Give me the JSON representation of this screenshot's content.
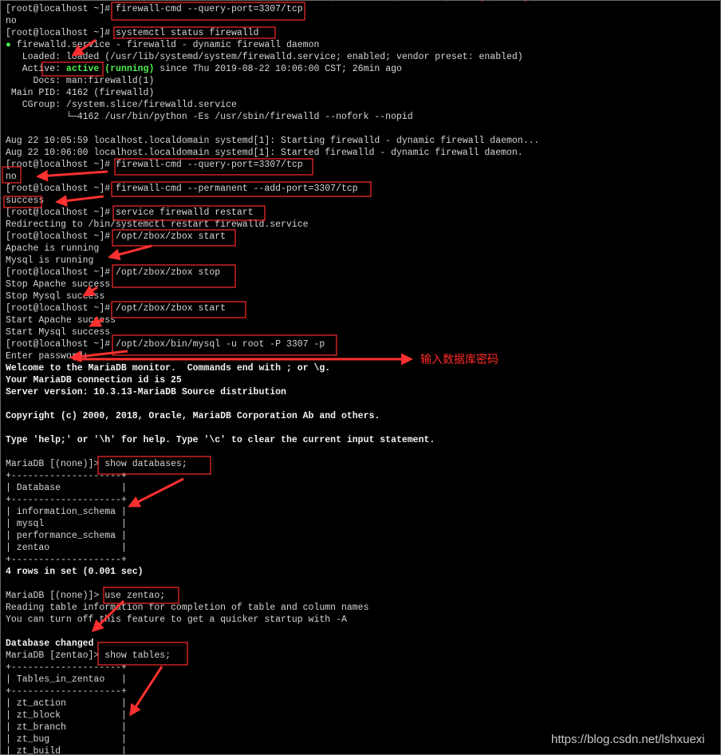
{
  "terminal": {
    "lines": [
      {
        "parts": [
          {
            "t": "Error: INVALID_PORT: bad port (most likely missing protocol), correct syntax is portid[-portid]/protocol",
            "c": "err"
          }
        ]
      },
      {
        "parts": [
          {
            "t": "[root@localhost ~]# firewall-cmd --query-port=3307/tcp"
          }
        ]
      },
      {
        "parts": [
          {
            "t": "no"
          }
        ]
      },
      {
        "parts": [
          {
            "t": "[root@localhost ~]# systemctl status firewalld"
          }
        ]
      },
      {
        "parts": [
          {
            "t": "●",
            "c": "dot"
          },
          {
            "t": " firewalld.service - firewalld - dynamic firewall daemon"
          }
        ]
      },
      {
        "parts": [
          {
            "t": "   Loaded: loaded (/usr/lib/systemd/system/firewalld.service; enabled; vendor preset: enabled)"
          }
        ]
      },
      {
        "parts": [
          {
            "t": "   Active: "
          },
          {
            "t": "active (running)",
            "c": "green"
          },
          {
            "t": " since Thu 2019-08-22 10:06:00 CST; 26min ago"
          }
        ]
      },
      {
        "parts": [
          {
            "t": "     Docs: man:firewalld(1)"
          }
        ]
      },
      {
        "parts": [
          {
            "t": " Main PID: 4162 (firewalld)"
          }
        ]
      },
      {
        "parts": [
          {
            "t": "   CGroup: /system.slice/firewalld.service"
          }
        ]
      },
      {
        "parts": [
          {
            "t": "           └─4162 /usr/bin/python -Es /usr/sbin/firewalld --nofork --nopid"
          }
        ]
      },
      {
        "parts": [
          {
            "t": ""
          }
        ]
      },
      {
        "parts": [
          {
            "t": "Aug 22 10:05:59 localhost.localdomain systemd[1]: Starting firewalld - dynamic firewall daemon..."
          }
        ]
      },
      {
        "parts": [
          {
            "t": "Aug 22 10:06:00 localhost.localdomain systemd[1]: Started firewalld - dynamic firewall daemon."
          }
        ]
      },
      {
        "parts": [
          {
            "t": "[root@localhost ~]# firewall-cmd --query-port=3307/tcp"
          }
        ]
      },
      {
        "parts": [
          {
            "t": "no"
          }
        ]
      },
      {
        "parts": [
          {
            "t": "[root@localhost ~]# firewall-cmd --permanent --add-port=3307/tcp"
          }
        ]
      },
      {
        "parts": [
          {
            "t": "success"
          }
        ]
      },
      {
        "parts": [
          {
            "t": "[root@localhost ~]# service firewalld restart"
          }
        ]
      },
      {
        "parts": [
          {
            "t": "Redirecting to /bin/systemctl restart firewalld.service"
          }
        ]
      },
      {
        "parts": [
          {
            "t": "[root@localhost ~]# /opt/zbox/zbox start"
          }
        ]
      },
      {
        "parts": [
          {
            "t": "Apache is running"
          }
        ]
      },
      {
        "parts": [
          {
            "t": "Mysql is running"
          }
        ]
      },
      {
        "parts": [
          {
            "t": "[root@localhost ~]# /opt/zbox/zbox stop"
          }
        ]
      },
      {
        "parts": [
          {
            "t": "Stop Apache success"
          }
        ]
      },
      {
        "parts": [
          {
            "t": "Stop Mysql success"
          }
        ]
      },
      {
        "parts": [
          {
            "t": "[root@localhost ~]# /opt/zbox/zbox start"
          }
        ]
      },
      {
        "parts": [
          {
            "t": "Start Apache success"
          }
        ]
      },
      {
        "parts": [
          {
            "t": "Start Mysql success"
          }
        ]
      },
      {
        "parts": [
          {
            "t": "[root@localhost ~]# /opt/zbox/bin/mysql -u root -P 3307 -p"
          }
        ]
      },
      {
        "parts": [
          {
            "t": "Enter password: "
          }
        ]
      },
      {
        "parts": [
          {
            "t": "Welcome to the MariaDB monitor.  Commands end with ; or \\g.",
            "c": "b"
          }
        ]
      },
      {
        "parts": [
          {
            "t": "Your MariaDB connection id is 25",
            "c": "b"
          }
        ]
      },
      {
        "parts": [
          {
            "t": "Server version: 10.3.13-MariaDB Source distribution",
            "c": "b"
          }
        ]
      },
      {
        "parts": [
          {
            "t": ""
          }
        ]
      },
      {
        "parts": [
          {
            "t": "Copyright (c) 2000, 2018, Oracle, MariaDB Corporation Ab and others.",
            "c": "b"
          }
        ]
      },
      {
        "parts": [
          {
            "t": ""
          }
        ]
      },
      {
        "parts": [
          {
            "t": "Type 'help;' or '\\h' for help. Type '\\c' to clear the current input statement.",
            "c": "b"
          }
        ]
      },
      {
        "parts": [
          {
            "t": ""
          }
        ]
      },
      {
        "parts": [
          {
            "t": "MariaDB [(none)]> show databases;"
          }
        ]
      },
      {
        "parts": [
          {
            "t": "+--------------------+"
          }
        ]
      },
      {
        "parts": [
          {
            "t": "| Database           |"
          }
        ]
      },
      {
        "parts": [
          {
            "t": "+--------------------+"
          }
        ]
      },
      {
        "parts": [
          {
            "t": "| information_schema |"
          }
        ]
      },
      {
        "parts": [
          {
            "t": "| mysql              |"
          }
        ]
      },
      {
        "parts": [
          {
            "t": "| performance_schema |"
          }
        ]
      },
      {
        "parts": [
          {
            "t": "| zentao             |"
          }
        ]
      },
      {
        "parts": [
          {
            "t": "+--------------------+"
          }
        ]
      },
      {
        "parts": [
          {
            "t": "4 rows in set (0.001 sec)",
            "c": "b"
          }
        ]
      },
      {
        "parts": [
          {
            "t": ""
          }
        ]
      },
      {
        "parts": [
          {
            "t": "MariaDB [(none)]> use zentao;"
          }
        ]
      },
      {
        "parts": [
          {
            "t": "Reading table information for completion of table and column names"
          }
        ]
      },
      {
        "parts": [
          {
            "t": "You can turn off this feature to get a quicker startup with -A"
          }
        ]
      },
      {
        "parts": [
          {
            "t": ""
          }
        ]
      },
      {
        "parts": [
          {
            "t": "Database changed",
            "c": "b"
          }
        ]
      },
      {
        "parts": [
          {
            "t": "MariaDB [zentao]> show tables;"
          }
        ]
      },
      {
        "parts": [
          {
            "t": "+--------------------+"
          }
        ]
      },
      {
        "parts": [
          {
            "t": "| Tables_in_zentao   |"
          }
        ]
      },
      {
        "parts": [
          {
            "t": "+--------------------+"
          }
        ]
      },
      {
        "parts": [
          {
            "t": "| zt_action          |"
          }
        ]
      },
      {
        "parts": [
          {
            "t": "| zt_block           |"
          }
        ]
      },
      {
        "parts": [
          {
            "t": "| zt_branch          |"
          }
        ]
      },
      {
        "parts": [
          {
            "t": "| zt_bug             |"
          }
        ]
      },
      {
        "parts": [
          {
            "t": "| zt_build           |"
          }
        ]
      }
    ]
  },
  "annotation": {
    "note": "输入数据库密码",
    "color": "#ff2a2a"
  },
  "watermark": "https://blog.csdn.net/lshxuexi",
  "colors": {
    "background": "#000000",
    "text": "#d6d6d6",
    "active": "#4cf04c",
    "highlight": "#ff2a2a"
  }
}
